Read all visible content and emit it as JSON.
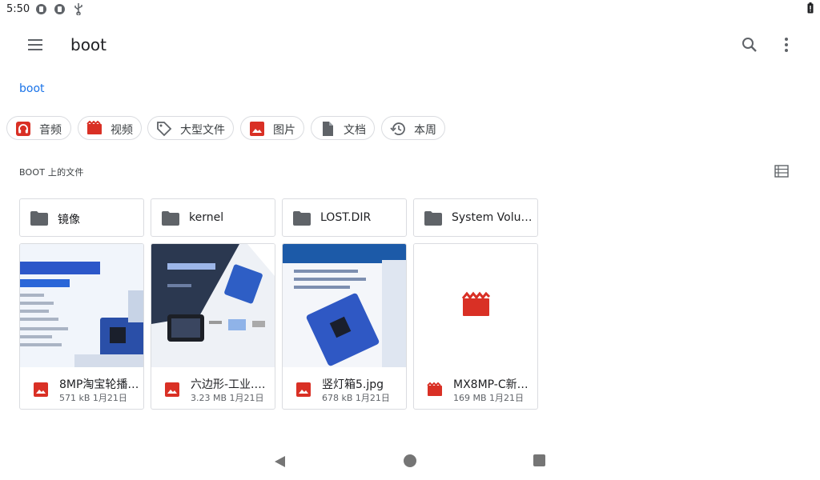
{
  "status": {
    "time": "5:50"
  },
  "toolbar": {
    "title": "boot"
  },
  "breadcrumb": {
    "label": "boot"
  },
  "chips": [
    {
      "label": "音频",
      "icon": "headphones-icon",
      "color": "#d93025"
    },
    {
      "label": "视频",
      "icon": "video-icon",
      "color": "#d93025"
    },
    {
      "label": "大型文件",
      "icon": "tag-icon",
      "color": "#5f6368"
    },
    {
      "label": "图片",
      "icon": "image-icon",
      "color": "#d93025"
    },
    {
      "label": "文档",
      "icon": "document-icon",
      "color": "#5f6368"
    },
    {
      "label": "本周",
      "icon": "history-icon",
      "color": "#5f6368"
    }
  ],
  "section": {
    "title": "BOOT 上的文件"
  },
  "folders": [
    {
      "name": "镜像"
    },
    {
      "name": "kernel"
    },
    {
      "name": "LOST.DIR"
    },
    {
      "name": "System Volu…"
    }
  ],
  "files": [
    {
      "name": "8MP淘宝轮播…",
      "meta": "571 kB 1月21日",
      "type": "image"
    },
    {
      "name": "六边形-工业.…",
      "meta": "3.23 MB 1月21日",
      "type": "image"
    },
    {
      "name": "竖灯箱5.jpg",
      "meta": "678 kB 1月21日",
      "type": "image"
    },
    {
      "name": "MX8MP-C新…",
      "meta": "169 MB 1月21日",
      "type": "video"
    }
  ],
  "colors": {
    "accent": "#1a73e8",
    "file_red": "#d93025",
    "icon_gray": "#5f6368"
  }
}
